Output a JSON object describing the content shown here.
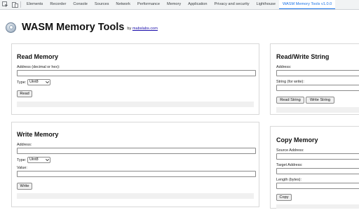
{
  "devtools": {
    "tabs": [
      "Elements",
      "Recorder",
      "Console",
      "Sources",
      "Network",
      "Performance",
      "Memory",
      "Application",
      "Privacy and security",
      "Lighthouse",
      "WASM Memory Tools v1.0.0"
    ],
    "active_tab": "WASM Memory Tools v1.0.0",
    "accent": "#1a73e8"
  },
  "header": {
    "title": "WASM Memory Tools",
    "by": "by",
    "author_link": "mabslabs.com"
  },
  "read_memory": {
    "title": "Read Memory",
    "address_label": "Address (decimal or hex):",
    "address_value": "",
    "type_label": "Type:",
    "type_value": "Uint8",
    "button": "Read"
  },
  "write_memory": {
    "title": "Write Memory",
    "address_label": "Address:",
    "address_value": "",
    "type_label": "Type:",
    "type_value": "Uint8",
    "value_label": "Value:",
    "value_value": "",
    "button": "Write"
  },
  "rw_string": {
    "title": "Read/Write String",
    "address_label": "Address:",
    "address_value": "",
    "string_label": "String (for write):",
    "string_value": "",
    "read_button": "Read String",
    "write_button": "Write String"
  },
  "copy_memory": {
    "title": "Copy Memory",
    "source_label": "Source Address:",
    "source_value": "",
    "target_label": "Target Address:",
    "target_value": "",
    "length_label": "Length (bytes):",
    "length_value": "",
    "button": "Copy"
  }
}
